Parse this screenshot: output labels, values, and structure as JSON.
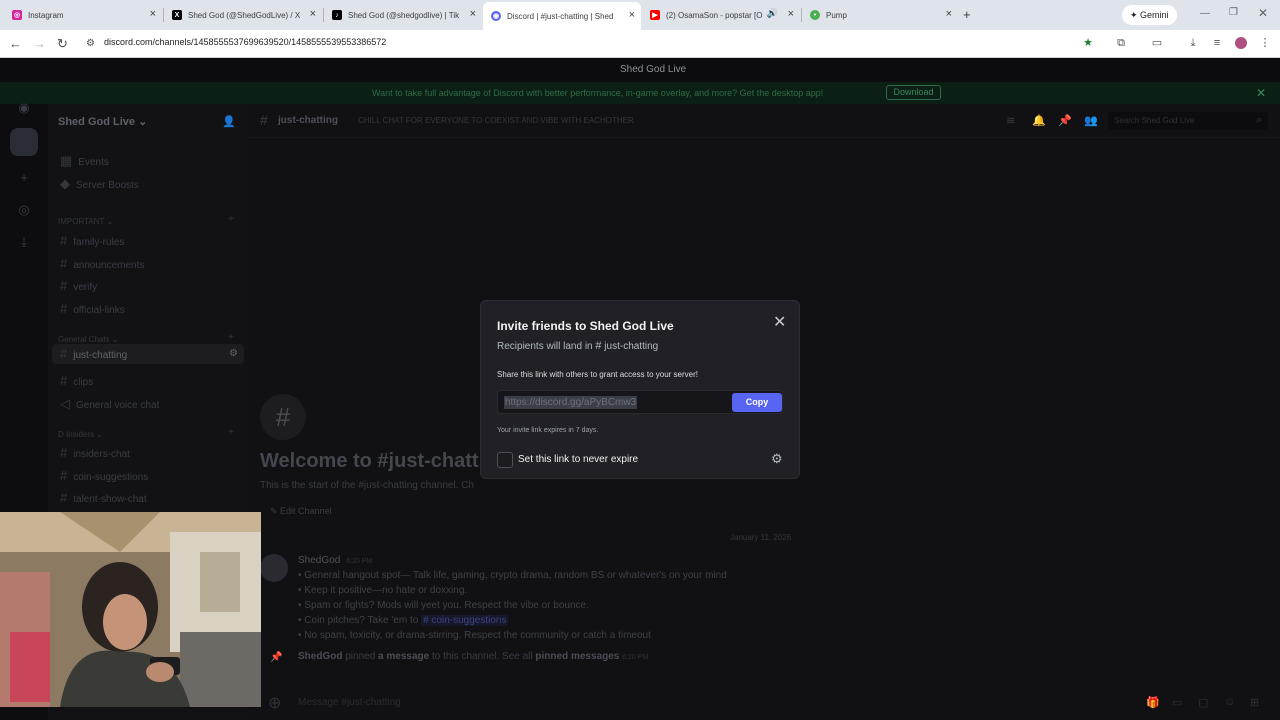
{
  "browser": {
    "tabs": [
      {
        "label": "Instagram",
        "icon": "instagram-icon",
        "color": "#d6249f"
      },
      {
        "label": "Shed God (@ShedGodLive) / X",
        "icon": "x-icon",
        "color": "#000000"
      },
      {
        "label": "Shed God (@shedgodlive) | Tik",
        "icon": "tiktok-icon",
        "color": "#000000"
      },
      {
        "label": "Discord | #just-chatting | Shed",
        "icon": "discord-icon",
        "color": "#5865f2"
      },
      {
        "label": "(2) OsamaSon - popstar [O",
        "icon": "youtube-icon",
        "color": "#ff0000"
      },
      {
        "label": "Pump",
        "icon": "pump-icon",
        "color": "#4caf50"
      }
    ],
    "gemini_label": "Gemini",
    "url": "discord.com/channels/1458555537699639520/1458555539553386572"
  },
  "discord": {
    "window_title": "Shed God Live",
    "banner_text": "Want to take full advantage of Discord with better performance, in-game overlay, and more? Get the desktop app!",
    "download_label": "Download",
    "server_name": "Shed God Live",
    "sidebar": {
      "events": "Events",
      "boosts": "Server Boosts",
      "cat_important": "IMPORTANT",
      "important_channels": [
        "family-rules",
        "announcements",
        "verify",
        "official-links"
      ],
      "cat_general": "General Chats",
      "general_channels": [
        "just-chatting",
        "clips"
      ],
      "voice_channel": "General voice chat",
      "cat_insiders": "D Insiders",
      "insider_channels": [
        "insiders-chat",
        "coin-suggestions",
        "talent-show-chat"
      ]
    },
    "header": {
      "channel": "just-chatting",
      "topic": "CHILL CHAT FOR EVERYONE TO COEXIST AND VIBE WITH EACHOTHER",
      "search_placeholder": "Search Shed God Live"
    },
    "welcome": {
      "title": "Welcome to #just-chatt",
      "subtitle": "This is the start of the #just-chatting channel. Ch",
      "edit": "Edit Channel"
    },
    "date_divider": "January 11, 2026",
    "message": {
      "author": "ShedGod",
      "time": "6:20 PM",
      "lines": [
        "• General hangout spot— Talk life, gaming, crypto drama, random BS or whatever's on your mind",
        "• Keep it positive—no hate or doxxing.",
        "• Spam or fights? Mods will yeet you. Respect the vibe or bounce.",
        "• Coin pitches? Take 'em to",
        "• No spam, toxicity, or drama-stirring. Respect the community or catch a timeout"
      ],
      "mention": "# coin-suggestions"
    },
    "pinned": {
      "author": "ShedGod",
      "text1": "pinned",
      "link1": "a message",
      "text2": "to this channel. See all",
      "link2": "pinned messages",
      "time": "6:20 PM"
    },
    "composer_placeholder": "Message #just-chatting"
  },
  "modal": {
    "title": "Invite friends to Shed God Live",
    "subtitle_prefix": "Recipients will land in",
    "subtitle_channel": "just-chatting",
    "share_text": "Share this link with others to grant access to your server!",
    "link": "https://discord.gg/aPyBCmw3",
    "copy_label": "Copy",
    "expiry": "Your invite link expires in 7 days.",
    "never_expire_label": "Set this link to never expire"
  }
}
